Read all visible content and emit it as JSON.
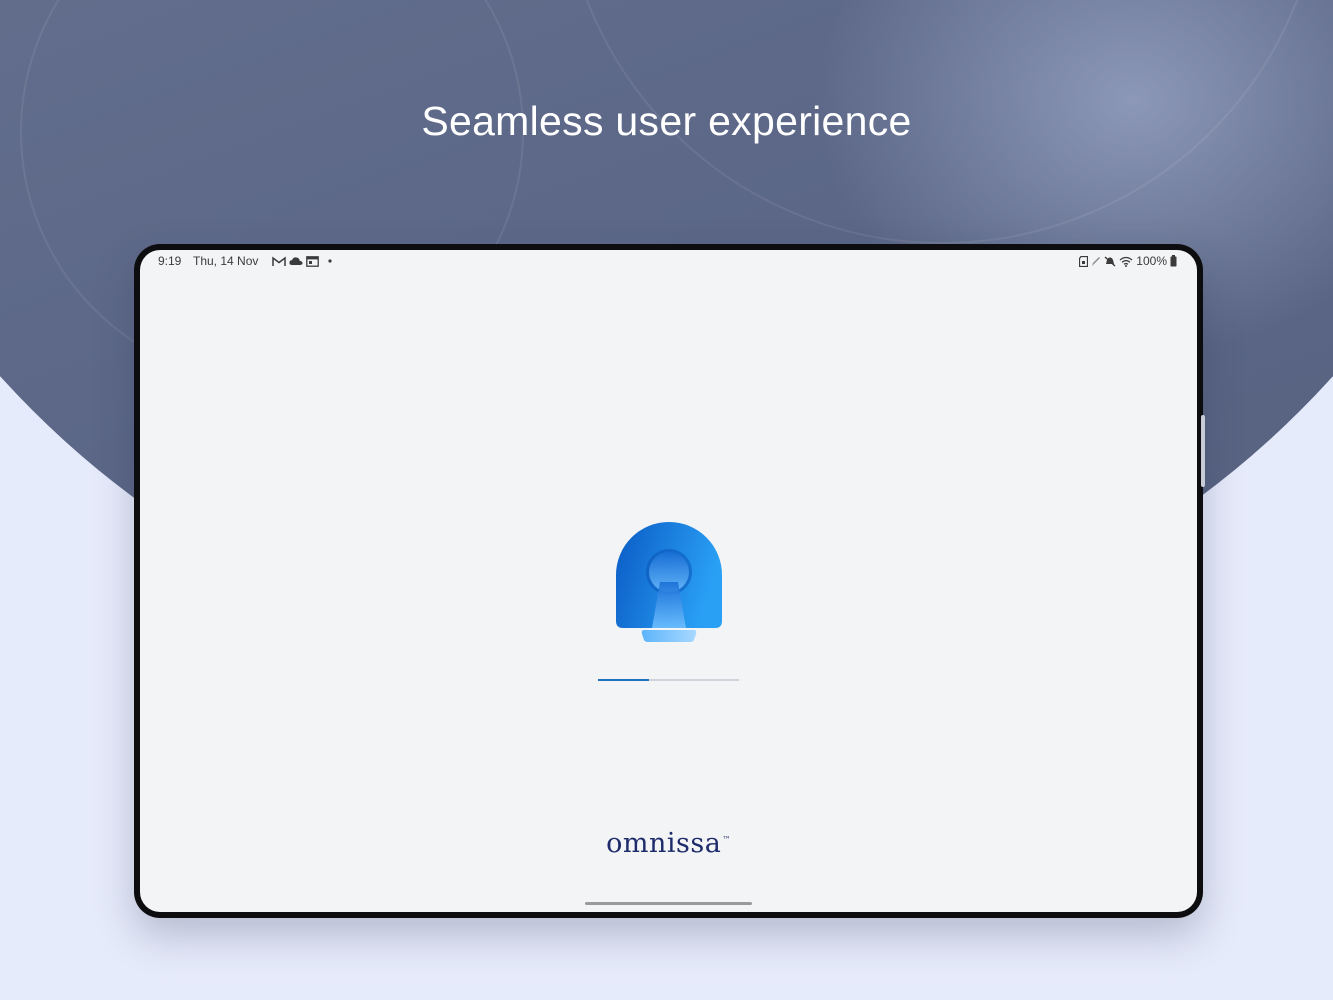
{
  "headline": "Seamless user experience",
  "status_bar": {
    "time": "9:19",
    "date": "Thu, 14 Nov",
    "battery": "100%",
    "left_icons": [
      "gmail-icon",
      "cloud-icon",
      "calendar-icon",
      "dot-icon"
    ],
    "right_icons": [
      "sd-card-icon",
      "pen-icon",
      "mute-icon",
      "wifi-icon",
      "battery-icon"
    ]
  },
  "splash": {
    "logo_icon": "keyhole-logo-icon",
    "progress_fraction": 0.36
  },
  "brand": {
    "name": "omnissa",
    "tm": "™"
  },
  "colors": {
    "background": "#e6ebfb",
    "hero_circle": "#65708f",
    "screen": "#f3f4f6",
    "accent_blue": "#1e72c4",
    "brand_navy": "#1d2b6b"
  }
}
